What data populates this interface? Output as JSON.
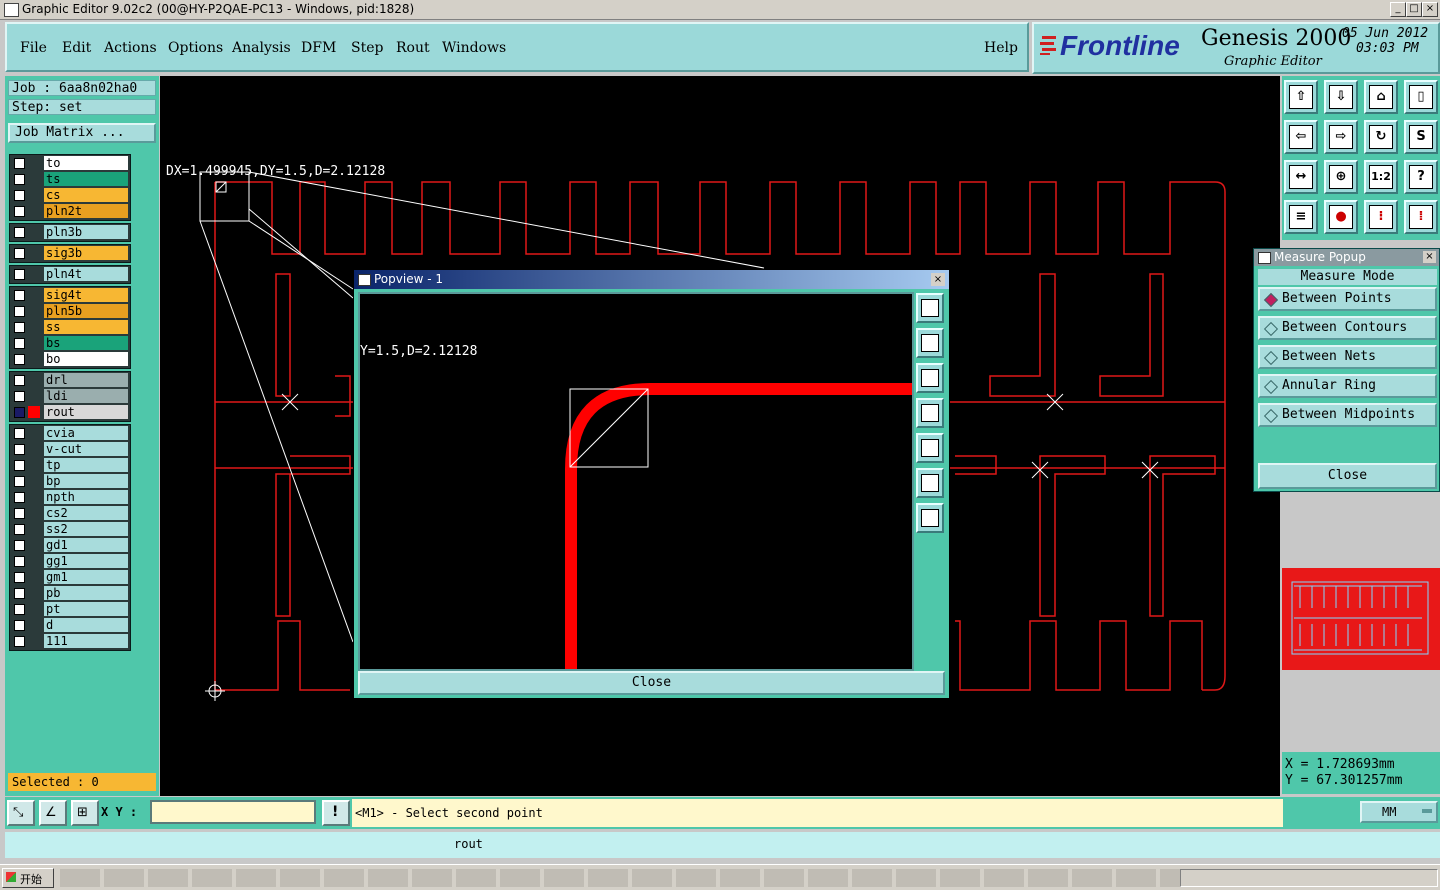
{
  "window": {
    "title": "Graphic Editor 9.02c2 (00@HY-P2QAE-PC13 - Windows, pid:1828)"
  },
  "menu": {
    "items": [
      "File",
      "Edit",
      "Actions",
      "Options",
      "Analysis",
      "DFM",
      "Step",
      "Rout",
      "Windows"
    ],
    "help": "Help"
  },
  "logo": {
    "brand": "Frontline",
    "product": "Genesis 2000",
    "subtitle": "Graphic Editor",
    "date": "05 Jun 2012",
    "time": "03:03 PM"
  },
  "job": {
    "job_line": "Job : 6aa8n02ha0",
    "step_line": "Step: set",
    "matrix_button": "Job Matrix ..."
  },
  "layers": {
    "group1": [
      {
        "name": "to",
        "color": "#ffffff"
      },
      {
        "name": "ts",
        "color": "#1aa37a"
      },
      {
        "name": "cs",
        "color": "#f7b733"
      },
      {
        "name": "pln2t",
        "color": "#e8a020"
      }
    ],
    "group2": [
      {
        "name": "pln3b",
        "color": "#a8dcdc"
      }
    ],
    "group3": [
      {
        "name": "sig3b",
        "color": "#f7b733"
      }
    ],
    "group4": [
      {
        "name": "pln4t",
        "color": "#a8dcdc"
      }
    ],
    "group5": [
      {
        "name": "sig4t",
        "color": "#f7b733"
      },
      {
        "name": "pln5b",
        "color": "#e8a020"
      },
      {
        "name": "ss",
        "color": "#f7b733"
      },
      {
        "name": "bs",
        "color": "#1aa37a"
      },
      {
        "name": "bo",
        "color": "#ffffff"
      }
    ],
    "group6": [
      {
        "name": "drl",
        "color": "#9aaeae"
      },
      {
        "name": "ldi",
        "color": "#9aaeae"
      },
      {
        "name": "rout",
        "color": "#d8d8d8"
      }
    ],
    "group7": [
      {
        "name": "cvia",
        "color": "#a8dcdc"
      },
      {
        "name": "v-cut",
        "color": "#a8dcdc"
      },
      {
        "name": "tp",
        "color": "#a8dcdc"
      },
      {
        "name": "bp",
        "color": "#a8dcdc"
      },
      {
        "name": "npth",
        "color": "#a8dcdc"
      },
      {
        "name": "cs2",
        "color": "#a8dcdc"
      },
      {
        "name": "ss2",
        "color": "#a8dcdc"
      },
      {
        "name": "gd1",
        "color": "#a8dcdc"
      },
      {
        "name": "gg1",
        "color": "#a8dcdc"
      },
      {
        "name": "gm1",
        "color": "#a8dcdc"
      },
      {
        "name": "pb",
        "color": "#a8dcdc"
      },
      {
        "name": "pt",
        "color": "#a8dcdc"
      },
      {
        "name": "d",
        "color": "#a8dcdc"
      },
      {
        "name": "111",
        "color": "#a8dcdc"
      }
    ]
  },
  "selected": "Selected : 0",
  "measure": {
    "dims": "DX=1.499945,DY=1.5,D=2.12128",
    "popup_title": "Measure Popup",
    "mode_label": "Measure Mode",
    "options": [
      "Between Points",
      "Between Contours",
      "Between Nets",
      "Annular Ring",
      "Between Midpoints"
    ],
    "close": "Close"
  },
  "popview": {
    "title": "Popview - 1",
    "dims": "Y=1.5,D=2.12128",
    "close": "Close"
  },
  "coords": {
    "x": "X  =  1.728693mm",
    "y": "Y  = 67.301257mm"
  },
  "status": {
    "xy_label": "X Y :",
    "prompt": "<M1> - Select second point",
    "units": "MM"
  },
  "command": {
    "layer": "rout"
  },
  "taskbar": {
    "start": "开始"
  },
  "colors": {
    "rout": "#ff0000",
    "panel": "#4fc7aa",
    "button": "#a8dcdc"
  }
}
